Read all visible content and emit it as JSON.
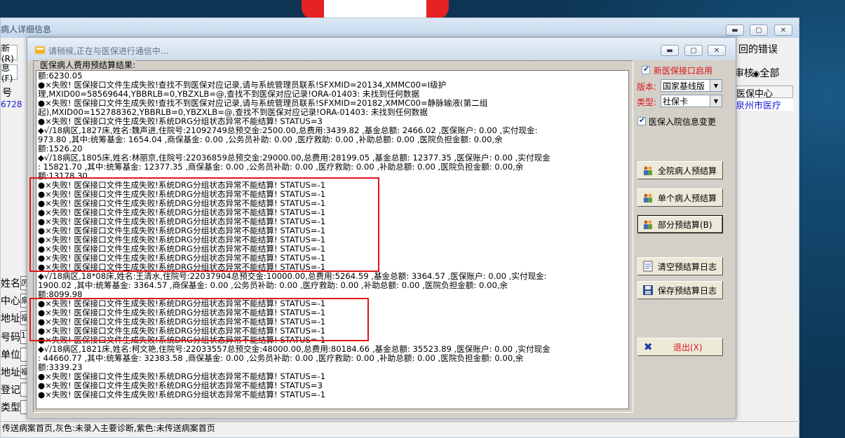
{
  "back_window": {
    "title": "病人详细信息",
    "left_buttons": [
      "新(R)",
      "息(F)"
    ],
    "left_header": "号",
    "left_value": "6728",
    "left_labels": [
      "姓名",
      "中心",
      "地址",
      "号码",
      "单位",
      "地址",
      "登记",
      "类型"
    ],
    "left_fields": [
      "厉",
      "泉",
      "福",
      "1",
      "",
      "福",
      "",
      ""
    ],
    "right_text_error": "回的错误",
    "right_text_review": "审核",
    "radio_all": "全部",
    "grid_header": "医保中心",
    "grid_cell": "泉州市医疗",
    "status_bar": "传送病案首页,灰色:未录入主要诊断,紫色:未传送病案首页"
  },
  "dialog": {
    "title": "请稍候,正在与医保进行通信中...",
    "group_caption": "医保病人费用预结算结果:",
    "log_lines": [
      "额:6230.05",
      "●×失败! 医保接口文件生成失败!查找不到医保对应记录,请与系统管理员联系!SFXMID=20134,XMMC00=Ⅰ级护",
      "理,MXID00=58569644,YBBRLB=0,YBZXLB=@,查找不到医保对应记录!ORA-01403: 未找到任何数据",
      "●×失败! 医保接口文件生成失败!查找不到医保对应记录,请与系统管理员联系!SFXMID=20182,XMMC00=静脉输液(第二组",
      "起),MXID00=152788362,YBBRLB=0,YBZXLB=@,查找不到医保对应记录!ORA-01403: 未找到任何数据",
      "●×失败! 医保接口文件生成失败!系统DRG分组状态异常不能结算! STATUS=3",
      "◆√/18病区,1827床,姓名:魏声进,住院号:21092749总预交金:2500.00,总费用:3439.82 ,基金总额: 2466.02 ,医保账户: 0.00 ,实付现金:",
      "973.80 ,其中:统筹基金: 1654.04 ,商保基金: 0.00 ,公务员补助: 0.00 ,医疗救助: 0.00 ,补助总额: 0.00 ,医院负担金额: 0.00,余",
      "额:1526.20",
      "◆√/18病区,1805床,姓名:林丽京,住院号:22036859总预交金:29000.00,总费用:28199.05 ,基金总额: 12377.35 ,医保账户: 0.00 ,实付现金",
      ": 15821.70 ,其中:统筹基金: 12377.35 ,商保基金: 0.00 ,公务员补助: 0.00 ,医疗救助: 0.00 ,补助总额: 0.00 ,医院负担金额: 0.00,余",
      "额:13178.30",
      "●×失败! 医保接口文件生成失败!系统DRG分组状态异常不能结算! STATUS=-1",
      "●×失败! 医保接口文件生成失败!系统DRG分组状态异常不能结算! STATUS=-1",
      "●×失败! 医保接口文件生成失败!系统DRG分组状态异常不能结算! STATUS=-1",
      "●×失败! 医保接口文件生成失败!系统DRG分组状态异常不能结算! STATUS=-1",
      "●×失败! 医保接口文件生成失败!系统DRG分组状态异常不能结算! STATUS=-1",
      "●×失败! 医保接口文件生成失败!系统DRG分组状态异常不能结算! STATUS=-1",
      "●×失败! 医保接口文件生成失败!系统DRG分组状态异常不能结算! STATUS=-1",
      "●×失败! 医保接口文件生成失败!系统DRG分组状态异常不能结算! STATUS=-1",
      "●×失败! 医保接口文件生成失败!系统DRG分组状态异常不能结算! STATUS=-1",
      "●×失败! 医保接口文件生成失败!系统DRG分组状态异常不能结算! STATUS=-1",
      "◆√/18病区,18*08床,姓名:王清水,住院号:22037904总预交金:10000.00,总费用:5264.59 ,基金总额: 3364.57 ,医保账户: 0.00 ,实付现金:",
      "1900.02 ,其中:统筹基金: 3364.57 ,商保基金: 0.00 ,公务员补助: 0.00 ,医疗救助: 0.00 ,补助总额: 0.00 ,医院负担金额: 0.00,余",
      "额:8099.98",
      "●×失败! 医保接口文件生成失败!系统DRG分组状态异常不能结算! STATUS=-1",
      "●×失败! 医保接口文件生成失败!系统DRG分组状态异常不能结算! STATUS=-1",
      "●×失败! 医保接口文件生成失败!系统DRG分组状态异常不能结算! STATUS=-1",
      "●×失败! 医保接口文件生成失败!系统DRG分组状态异常不能结算! STATUS=-1",
      "●×失败! 医保接口文件生成失败!系统DRG分组状态异常不能结算! STATUS=-1",
      "◆√/18病区,1821床,姓名:柯文艳,住院号:22033557总预交金:48000.00,总费用:80184.66 ,基金总额: 35523.89 ,医保账户: 0.00 ,实付现金",
      ": 44660.77 ,其中:统筹基金: 32383.58 ,商保基金: 0.00 ,公务员补助: 0.00 ,医疗救助: 0.00 ,补助总额: 0.00 ,医院负担金额: 0.00,余",
      "额:3339.23",
      "●×失败! 医保接口文件生成失败!系统DRG分组状态异常不能结算! STATUS=-1",
      "●×失败! 医保接口文件生成失败!系统DRG分组状态异常不能结算! STATUS=3",
      "●×失败! 医保接口文件生成失败!系统DRG分组状态异常不能结算! STATUS=-1"
    ],
    "right_panel": {
      "new_interface_label": "新医保接口启用",
      "version_label": "版本:",
      "version_value": "国家基线版",
      "type_label": "类型:",
      "type_value": "社保卡",
      "admission_change_label": "医保入院信息变更",
      "btn_all_patients": "全院病人预结算",
      "btn_single_patient": "单个病人预结算",
      "btn_partial": "部分预结算(B)",
      "btn_clear_log": "清空预结算日志",
      "btn_save_log": "保存预结算日志",
      "btn_exit": "退出(X)"
    }
  },
  "colors": {
    "highlight_red": "#e0141b",
    "label_red": "#e0141b",
    "link_blue": "#1a1ad0"
  }
}
